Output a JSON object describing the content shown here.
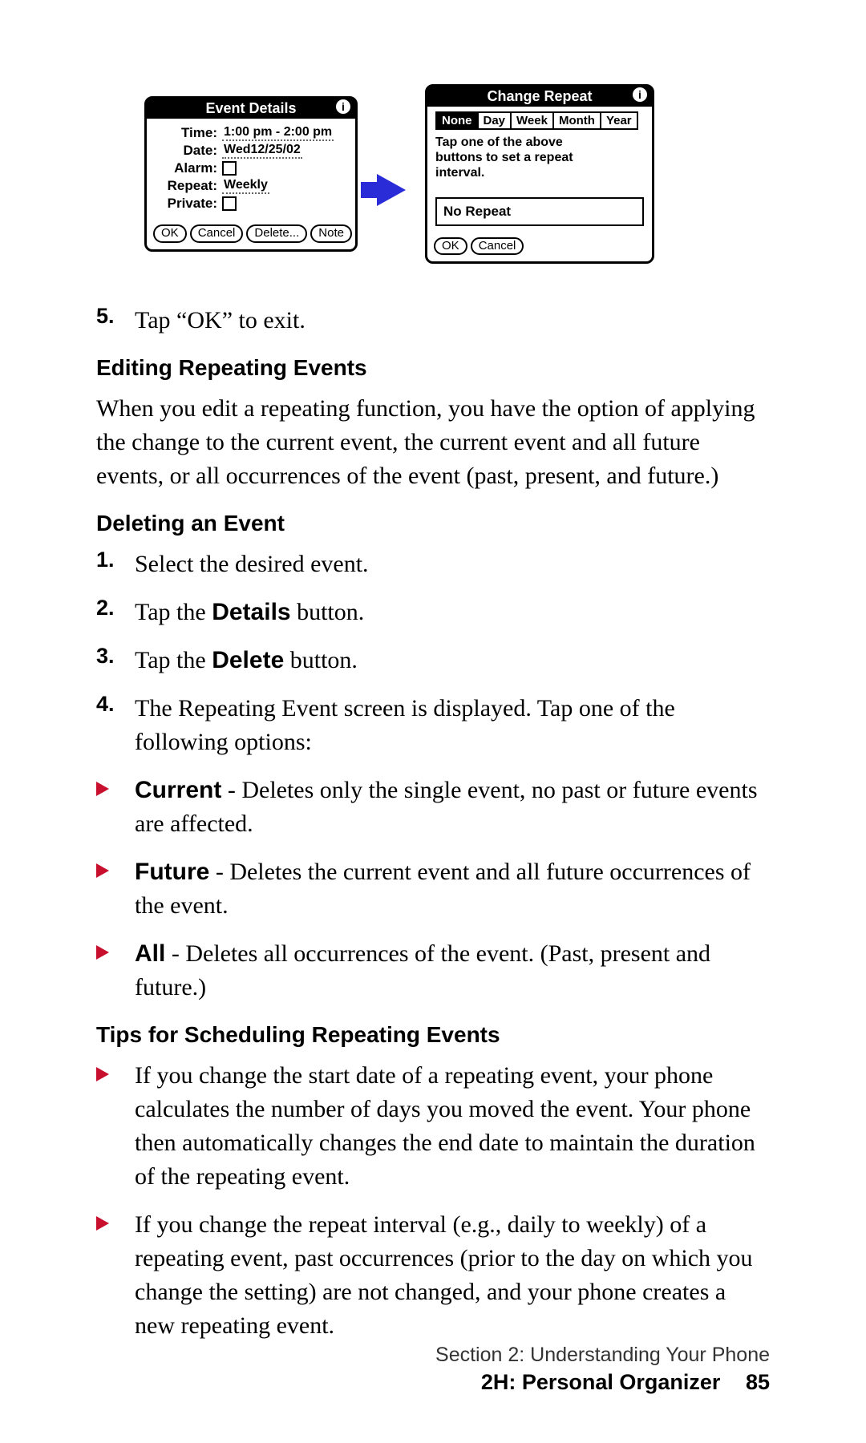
{
  "screen1": {
    "title": "Event Details",
    "time_label": "Time:",
    "time_value": "1:00 pm - 2:00 pm",
    "date_label": "Date:",
    "date_value": "Wed12/25/02",
    "alarm_label": "Alarm:",
    "repeat_label": "Repeat:",
    "repeat_value": "Weekly",
    "private_label": "Private:",
    "btn_ok": "OK",
    "btn_cancel": "Cancel",
    "btn_delete": "Delete...",
    "btn_note": "Note"
  },
  "screen2": {
    "title": "Change Repeat",
    "segs": {
      "none": "None",
      "day": "Day",
      "week": "Week",
      "month": "Month",
      "year": "Year"
    },
    "instr": "Tap one of the above buttons to set a repeat interval.",
    "status": "No Repeat",
    "btn_ok": "OK",
    "btn_cancel": "Cancel"
  },
  "step5": {
    "num": "5.",
    "text": "Tap “OK” to exit."
  },
  "h1": "Editing Repeating Events",
  "p1": "When you edit a repeating function, you have the option of applying the change to the current event, the current event and all future events, or all occurrences of the event (past, present, and future.)",
  "h2": "Deleting an Event",
  "del_steps": {
    "s1": {
      "num": "1.",
      "text": "Select the desired event."
    },
    "s2": {
      "num": "2.",
      "pre": "Tap the ",
      "bold": "Details",
      "post": " button."
    },
    "s3": {
      "num": "3.",
      "pre": "Tap the ",
      "bold": "Delete",
      "post": " button."
    },
    "s4": {
      "num": "4.",
      "text": "The Repeating Event screen is displayed. Tap one of the following options:"
    }
  },
  "opts": {
    "current": {
      "bold": "Current",
      "rest": " - Deletes only the single event, no past or future events are affected."
    },
    "future": {
      "bold": "Future",
      "rest": " - Deletes the current event and all future occurrences of the event."
    },
    "all": {
      "bold": "All",
      "rest": " - Deletes all occurrences of the event. (Past, present and future.)"
    }
  },
  "h3": "Tips for Scheduling Repeating Events",
  "tips": {
    "t1": "If you change the start date of a repeating event, your phone calculates the number of days you moved the event. Your phone then automatically changes the end date to maintain the duration of the repeating event.",
    "t2": "If you change the repeat interval (e.g., daily to weekly) of a repeating event, past occurrences (prior to the day on which you change the setting) are not changed, and your phone creates a new repeating event."
  },
  "footer": {
    "section": "Section 2: Understanding Your Phone",
    "chapter": "2H: Personal Organizer",
    "page": "85"
  }
}
